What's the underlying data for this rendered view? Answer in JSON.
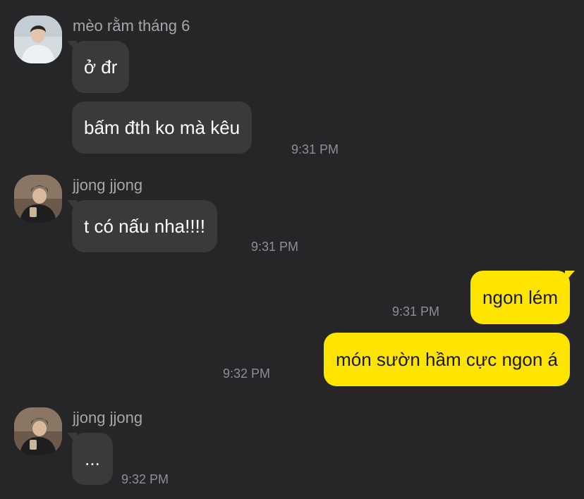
{
  "groups": [
    {
      "sender": "mèo rằm tháng 6",
      "avatar_icon": "avatar-meo-ram-thang-6",
      "messages": [
        {
          "text": "ở đr",
          "time": ""
        },
        {
          "text": "bấm đth ko mà kêu",
          "time": "9:31 PM"
        }
      ]
    },
    {
      "sender": "jjong jjong",
      "avatar_icon": "avatar-jjong-jjong",
      "messages": [
        {
          "text": "t có nấu nha!!!!",
          "time": "9:31 PM"
        }
      ]
    },
    {
      "sender": "",
      "messages": [
        {
          "text": "ngon lém",
          "time": "9:31 PM"
        },
        {
          "text": "món sườn hầm cực ngon á",
          "time": "9:32 PM"
        }
      ]
    },
    {
      "sender": "jjong jjong",
      "avatar_icon": "avatar-jjong-jjong",
      "messages": [
        {
          "text": "...",
          "time": "9:32 PM"
        }
      ]
    }
  ],
  "colors": {
    "background": "#262628",
    "incoming_bubble": "#3a3a3c",
    "outgoing_bubble": "#fee500",
    "sender_name": "#a7a7aa",
    "timestamp": "#8e8e93"
  }
}
